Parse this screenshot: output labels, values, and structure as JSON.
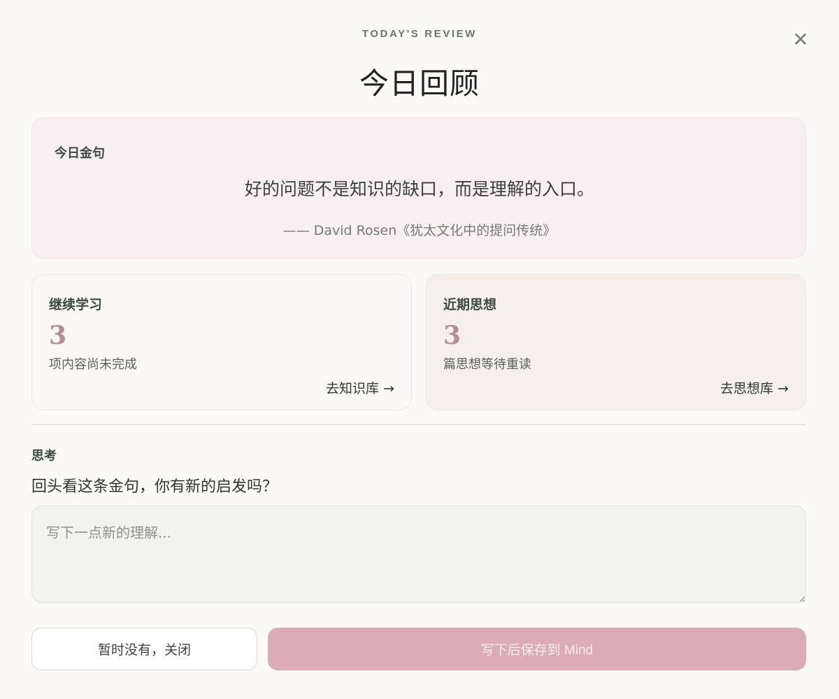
{
  "header": {
    "eyebrow": "TODAY'S REVIEW",
    "title": "今日回顾",
    "close_label": "✕"
  },
  "quote_card": {
    "label": "今日金句",
    "text": "好的问题不是知识的缺口，而是理解的入口。",
    "source": "—— David Rosen《犹太文化中的提问传统》"
  },
  "stats": {
    "learning": {
      "title": "继续学习",
      "count": "3",
      "description": "项内容尚未完成",
      "link_label": "去知识库 →"
    },
    "thoughts": {
      "title": "近期思想",
      "count": "3",
      "description": "篇思想等待重读",
      "link_label": "去思想库 →"
    }
  },
  "reflection": {
    "label": "思考",
    "question": "回头看这条金句，你有新的启发吗？",
    "placeholder": "写下一点新的理解...",
    "value": ""
  },
  "actions": {
    "dismiss_label": "暂时没有，关闭",
    "save_label": "写下后保存到 Mind"
  },
  "colors": {
    "accent": "#dbacb6",
    "quote_bg": "#f8eff3",
    "number": "#b48d97"
  }
}
